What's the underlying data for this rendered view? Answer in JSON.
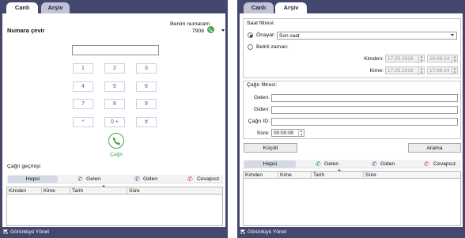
{
  "tabs": {
    "live": "Canlı",
    "archive": "Arşiv"
  },
  "colors": {
    "frame": "#44476e",
    "accent_green": "#47a84e",
    "incoming": "#2f9a3c",
    "outgoing": "#3b5a9a",
    "missed": "#d23b3b"
  },
  "live": {
    "dial_label": "Numara çevir",
    "my_number_label": "Benim numaram",
    "my_number": "7908",
    "number_input_value": "",
    "keypad": [
      "1",
      "2",
      "3",
      "4",
      "5",
      "6",
      "7",
      "8",
      "9",
      "*",
      "0 +",
      "#"
    ],
    "call_label": "Çağrı",
    "history_label": "Çağrı geçmişi:"
  },
  "history": {
    "filters": [
      "Hepsi",
      "Gelen",
      "Giden",
      "Cevapsız"
    ],
    "columns": [
      "Kimden",
      "Kime",
      "Tarih",
      "Süre"
    ],
    "sorted_column": "Tarih"
  },
  "archive": {
    "time_filter_label": "Saat filtresi:",
    "preset_radio_label": "Önayar:",
    "preset_value": "Son saat",
    "custom_radio_label": "Belirli zaman:",
    "from_label": "Kimden:",
    "to_label": "Kime:",
    "from_date": "17.05.2019",
    "from_time": "16:06:14",
    "to_date": "17.05.2019",
    "to_time": "17:06:14",
    "call_filter_label": "Çağrı filtresi:",
    "incoming_label": "Gelen:",
    "outgoing_label": "Giden:",
    "call_id_label": "Çağrı ID:",
    "duration_label": "Süre:",
    "duration_value": "00:00:00",
    "collapse_button": "Küçült",
    "search_button": "Arama"
  },
  "footer": {
    "manage_view": "Görüntüyü Yönet"
  }
}
